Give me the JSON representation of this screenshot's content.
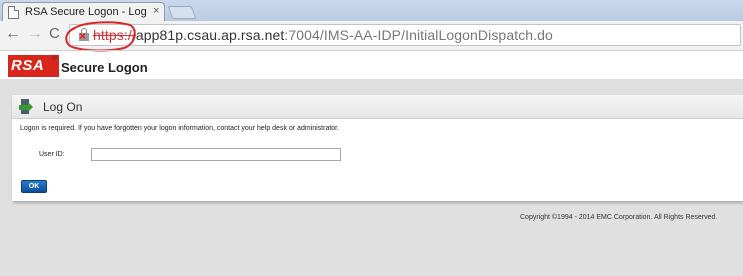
{
  "browser": {
    "tab_title": "RSA Secure Logon - Log C",
    "tab_close": "×",
    "url_scheme": "https://",
    "url_host": "app81p.csau.ap.rsa.net",
    "url_path": ":7004/IMS-AA-IDP/InitialLogonDispatch.do",
    "nav": {
      "back": "←",
      "forward": "→",
      "reload": "C"
    }
  },
  "header": {
    "logo": "RSA",
    "logo_reg": "®",
    "title": "Secure Logon"
  },
  "panel": {
    "title": "Log On",
    "info": "Logon is required. If you have forgotten your logon information, contact your help desk or administrator.",
    "userid_label": "User ID:",
    "userid_value": "",
    "ok_label": "OK"
  },
  "footer": {
    "copyright": "Copyright ©1994 - 2014 EMC Corporation. All Rights Reserved."
  },
  "colors": {
    "rsa_red": "#d9261c",
    "ok_blue": "#0a4f9e",
    "annotation_red": "#d62a2a"
  }
}
